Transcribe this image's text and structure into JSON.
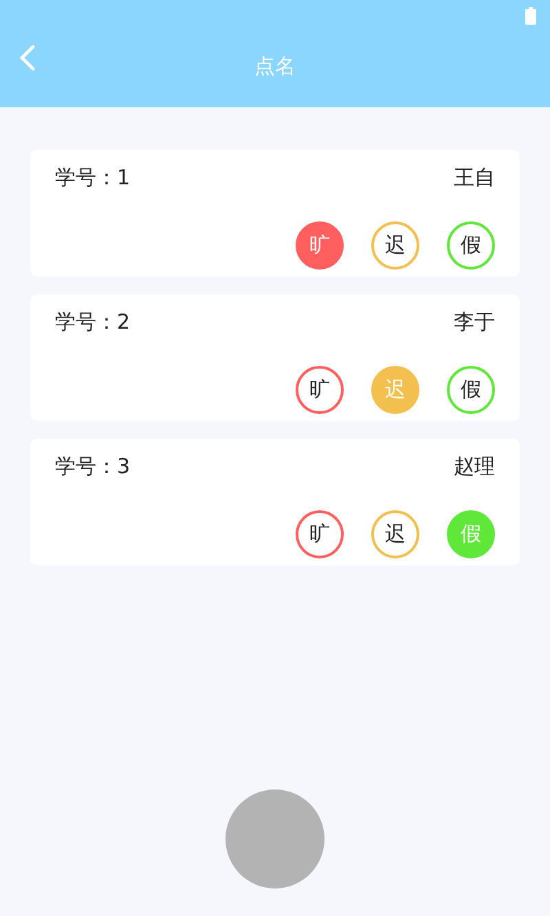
{
  "header": {
    "title": "点名"
  },
  "students": [
    {
      "number": "学号：1",
      "name": "王自",
      "marks": [
        {
          "label": "旷",
          "color": "#ff5f5f",
          "selected": true
        },
        {
          "label": "迟",
          "color": "#f3c04f",
          "selected": false
        },
        {
          "label": "假",
          "color": "#5fe83a",
          "selected": false
        }
      ]
    },
    {
      "number": "学号：2",
      "name": "李于",
      "marks": [
        {
          "label": "旷",
          "color": "#ff5f5f",
          "selected": false
        },
        {
          "label": "迟",
          "color": "#f3c04f",
          "selected": true
        },
        {
          "label": "假",
          "color": "#5fe83a",
          "selected": false
        }
      ]
    },
    {
      "number": "学号：3",
      "name": "赵理",
      "marks": [
        {
          "label": "旷",
          "color": "#ff5f5f",
          "selected": false
        },
        {
          "label": "迟",
          "color": "#f3c04f",
          "selected": false
        },
        {
          "label": "假",
          "color": "#5fe83a",
          "selected": true
        }
      ]
    }
  ]
}
